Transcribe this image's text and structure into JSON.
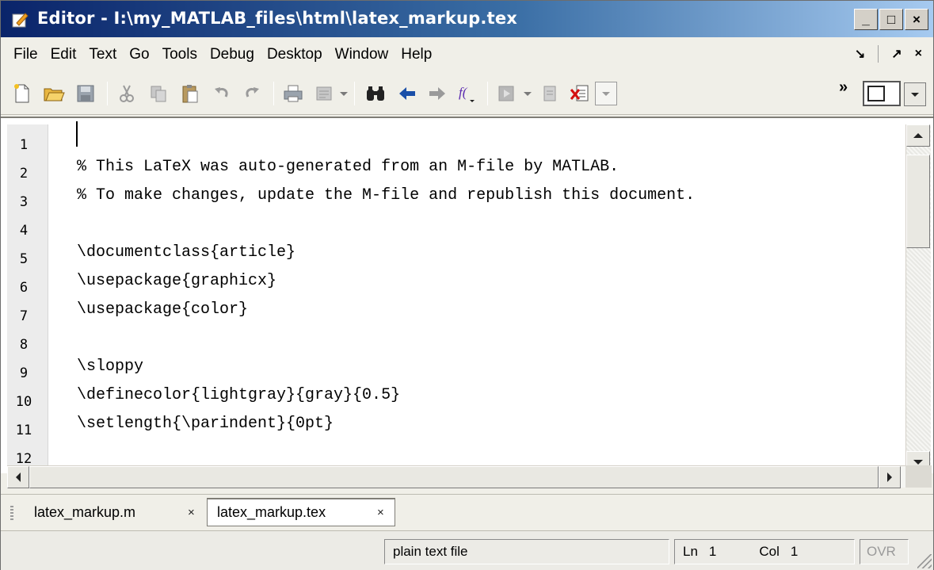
{
  "window": {
    "title": "Editor - I:\\my_MATLAB_files\\html\\latex_markup.tex",
    "minimize": "_",
    "maximize": "□",
    "close": "×"
  },
  "menubar": {
    "items": [
      "File",
      "Edit",
      "Text",
      "Go",
      "Tools",
      "Debug",
      "Desktop",
      "Window",
      "Help"
    ],
    "undock_label": "↘",
    "maximize_label": "↗",
    "close_label": "×"
  },
  "toolbar": {
    "icons": [
      "new-file-icon",
      "open-file-icon",
      "save-icon",
      "cut-icon",
      "copy-icon",
      "paste-icon",
      "undo-icon",
      "redo-icon",
      "print-icon",
      "publish-icon",
      "find-icon",
      "back-icon",
      "forward-icon",
      "function-icon",
      "run-icon",
      "stack-icon",
      "clear-breakpoints-icon",
      "cell-mode-icon"
    ],
    "overflow_label": "»"
  },
  "editor": {
    "lines": [
      {
        "num": "1",
        "text": ""
      },
      {
        "num": "2",
        "text": "% This LaTeX was auto-generated from an M-file by MATLAB."
      },
      {
        "num": "3",
        "text": "% To make changes, update the M-file and republish this document."
      },
      {
        "num": "4",
        "text": ""
      },
      {
        "num": "5",
        "text": "\\documentclass{article}"
      },
      {
        "num": "6",
        "text": "\\usepackage{graphicx}"
      },
      {
        "num": "7",
        "text": "\\usepackage{color}"
      },
      {
        "num": "8",
        "text": ""
      },
      {
        "num": "9",
        "text": "\\sloppy"
      },
      {
        "num": "10",
        "text": "\\definecolor{lightgray}{gray}{0.5}"
      },
      {
        "num": "11",
        "text": "\\setlength{\\parindent}{0pt}"
      },
      {
        "num": "12",
        "text": ""
      }
    ]
  },
  "tabs": [
    {
      "label": "latex_markup.m",
      "close": "×",
      "active": false
    },
    {
      "label": "latex_markup.tex",
      "close": "×",
      "active": true
    }
  ],
  "status": {
    "file_type": "plain text file",
    "ln_label": "Ln",
    "ln_value": "1",
    "col_label": "Col",
    "col_value": "1",
    "ovr": "OVR"
  },
  "colors": {
    "title_bar_start": "#0a246a",
    "title_bar_end": "#a6caf0",
    "window_bg": "#f0efe8",
    "editor_bg": "#ffffff"
  }
}
